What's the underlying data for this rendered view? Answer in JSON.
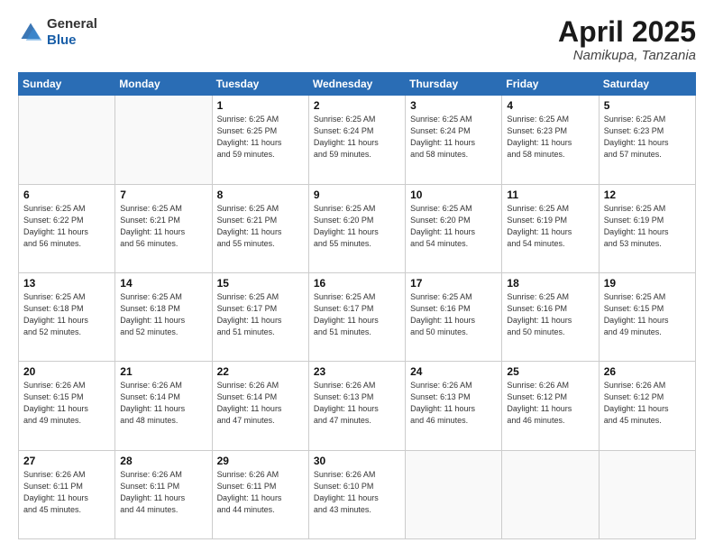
{
  "header": {
    "logo": {
      "general": "General",
      "blue": "Blue"
    },
    "title": "April 2025",
    "location": "Namikupa, Tanzania"
  },
  "weekdays": [
    "Sunday",
    "Monday",
    "Tuesday",
    "Wednesday",
    "Thursday",
    "Friday",
    "Saturday"
  ],
  "weeks": [
    [
      {
        "day": "",
        "info": ""
      },
      {
        "day": "",
        "info": ""
      },
      {
        "day": "1",
        "info": "Sunrise: 6:25 AM\nSunset: 6:25 PM\nDaylight: 11 hours\nand 59 minutes."
      },
      {
        "day": "2",
        "info": "Sunrise: 6:25 AM\nSunset: 6:24 PM\nDaylight: 11 hours\nand 59 minutes."
      },
      {
        "day": "3",
        "info": "Sunrise: 6:25 AM\nSunset: 6:24 PM\nDaylight: 11 hours\nand 58 minutes."
      },
      {
        "day": "4",
        "info": "Sunrise: 6:25 AM\nSunset: 6:23 PM\nDaylight: 11 hours\nand 58 minutes."
      },
      {
        "day": "5",
        "info": "Sunrise: 6:25 AM\nSunset: 6:23 PM\nDaylight: 11 hours\nand 57 minutes."
      }
    ],
    [
      {
        "day": "6",
        "info": "Sunrise: 6:25 AM\nSunset: 6:22 PM\nDaylight: 11 hours\nand 56 minutes."
      },
      {
        "day": "7",
        "info": "Sunrise: 6:25 AM\nSunset: 6:21 PM\nDaylight: 11 hours\nand 56 minutes."
      },
      {
        "day": "8",
        "info": "Sunrise: 6:25 AM\nSunset: 6:21 PM\nDaylight: 11 hours\nand 55 minutes."
      },
      {
        "day": "9",
        "info": "Sunrise: 6:25 AM\nSunset: 6:20 PM\nDaylight: 11 hours\nand 55 minutes."
      },
      {
        "day": "10",
        "info": "Sunrise: 6:25 AM\nSunset: 6:20 PM\nDaylight: 11 hours\nand 54 minutes."
      },
      {
        "day": "11",
        "info": "Sunrise: 6:25 AM\nSunset: 6:19 PM\nDaylight: 11 hours\nand 54 minutes."
      },
      {
        "day": "12",
        "info": "Sunrise: 6:25 AM\nSunset: 6:19 PM\nDaylight: 11 hours\nand 53 minutes."
      }
    ],
    [
      {
        "day": "13",
        "info": "Sunrise: 6:25 AM\nSunset: 6:18 PM\nDaylight: 11 hours\nand 52 minutes."
      },
      {
        "day": "14",
        "info": "Sunrise: 6:25 AM\nSunset: 6:18 PM\nDaylight: 11 hours\nand 52 minutes."
      },
      {
        "day": "15",
        "info": "Sunrise: 6:25 AM\nSunset: 6:17 PM\nDaylight: 11 hours\nand 51 minutes."
      },
      {
        "day": "16",
        "info": "Sunrise: 6:25 AM\nSunset: 6:17 PM\nDaylight: 11 hours\nand 51 minutes."
      },
      {
        "day": "17",
        "info": "Sunrise: 6:25 AM\nSunset: 6:16 PM\nDaylight: 11 hours\nand 50 minutes."
      },
      {
        "day": "18",
        "info": "Sunrise: 6:25 AM\nSunset: 6:16 PM\nDaylight: 11 hours\nand 50 minutes."
      },
      {
        "day": "19",
        "info": "Sunrise: 6:25 AM\nSunset: 6:15 PM\nDaylight: 11 hours\nand 49 minutes."
      }
    ],
    [
      {
        "day": "20",
        "info": "Sunrise: 6:26 AM\nSunset: 6:15 PM\nDaylight: 11 hours\nand 49 minutes."
      },
      {
        "day": "21",
        "info": "Sunrise: 6:26 AM\nSunset: 6:14 PM\nDaylight: 11 hours\nand 48 minutes."
      },
      {
        "day": "22",
        "info": "Sunrise: 6:26 AM\nSunset: 6:14 PM\nDaylight: 11 hours\nand 47 minutes."
      },
      {
        "day": "23",
        "info": "Sunrise: 6:26 AM\nSunset: 6:13 PM\nDaylight: 11 hours\nand 47 minutes."
      },
      {
        "day": "24",
        "info": "Sunrise: 6:26 AM\nSunset: 6:13 PM\nDaylight: 11 hours\nand 46 minutes."
      },
      {
        "day": "25",
        "info": "Sunrise: 6:26 AM\nSunset: 6:12 PM\nDaylight: 11 hours\nand 46 minutes."
      },
      {
        "day": "26",
        "info": "Sunrise: 6:26 AM\nSunset: 6:12 PM\nDaylight: 11 hours\nand 45 minutes."
      }
    ],
    [
      {
        "day": "27",
        "info": "Sunrise: 6:26 AM\nSunset: 6:11 PM\nDaylight: 11 hours\nand 45 minutes."
      },
      {
        "day": "28",
        "info": "Sunrise: 6:26 AM\nSunset: 6:11 PM\nDaylight: 11 hours\nand 44 minutes."
      },
      {
        "day": "29",
        "info": "Sunrise: 6:26 AM\nSunset: 6:11 PM\nDaylight: 11 hours\nand 44 minutes."
      },
      {
        "day": "30",
        "info": "Sunrise: 6:26 AM\nSunset: 6:10 PM\nDaylight: 11 hours\nand 43 minutes."
      },
      {
        "day": "",
        "info": ""
      },
      {
        "day": "",
        "info": ""
      },
      {
        "day": "",
        "info": ""
      }
    ]
  ]
}
